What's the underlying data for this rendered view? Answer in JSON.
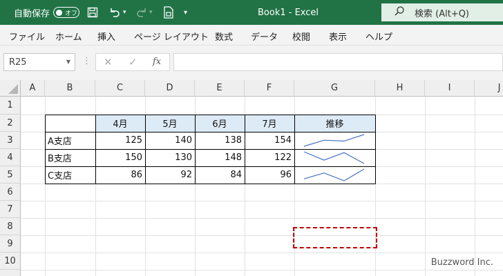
{
  "titlebar": {
    "autosave_label": "自動保存",
    "autosave_state": "オフ",
    "doc_title": "Book1  -  Excel",
    "search_placeholder": "検索 (Alt+Q)",
    "bg_color": "#217346",
    "icons": [
      "save-icon",
      "undo-icon",
      "redo-icon",
      "document-icon",
      "customize-qat-icon",
      "search-icon"
    ]
  },
  "menu": [
    "ファイル",
    "ホーム",
    "挿入",
    "ページ レイアウト",
    "数式",
    "データ",
    "校閲",
    "表示",
    "ヘルプ"
  ],
  "formula_bar": {
    "name_box": "R25",
    "fx_label": "fx",
    "formula": ""
  },
  "sheet": {
    "columns": [
      "A",
      "B",
      "C",
      "D",
      "E",
      "F",
      "G",
      "H",
      "I",
      "J"
    ],
    "rows": [
      "1",
      "2",
      "3",
      "4",
      "5",
      "6",
      "7",
      "8",
      "9",
      "10"
    ],
    "table": {
      "headers": [
        "4月",
        "5月",
        "6月",
        "7月",
        "推移"
      ],
      "rows": [
        {
          "name": "A支店",
          "values": [
            "125",
            "140",
            "138",
            "154"
          ]
        },
        {
          "name": "B支店",
          "values": [
            "150",
            "130",
            "148",
            "122"
          ]
        },
        {
          "name": "C支店",
          "values": [
            "86",
            "92",
            "84",
            "96"
          ]
        }
      ],
      "header_fill": "#ddebf7"
    },
    "sparkline_color": "#4472c4",
    "highlight_color": "#c00000"
  },
  "watermark": "Buzzword Inc."
}
